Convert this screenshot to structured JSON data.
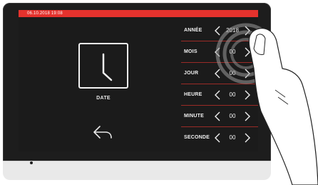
{
  "statusbar": {
    "datetime": "06.10.2018  19:08"
  },
  "main": {
    "title": "DATE"
  },
  "icons": {
    "clock": "clock-icon",
    "back": "back-arrow-icon",
    "prev": "chevron-left-icon",
    "next": "chevron-right-icon"
  },
  "settings": [
    {
      "label": "ANNÉE",
      "value": "2018"
    },
    {
      "label": "MOIS",
      "value": "00"
    },
    {
      "label": "JOUR",
      "value": "00"
    },
    {
      "label": "HEURE",
      "value": "00"
    },
    {
      "label": "MINUTE",
      "value": "00"
    },
    {
      "label": "SECONDE",
      "value": "00"
    }
  ],
  "colors": {
    "accent": "#e5322d",
    "screen_bg": "#1b1b1b",
    "divider": "#9a2b27"
  }
}
